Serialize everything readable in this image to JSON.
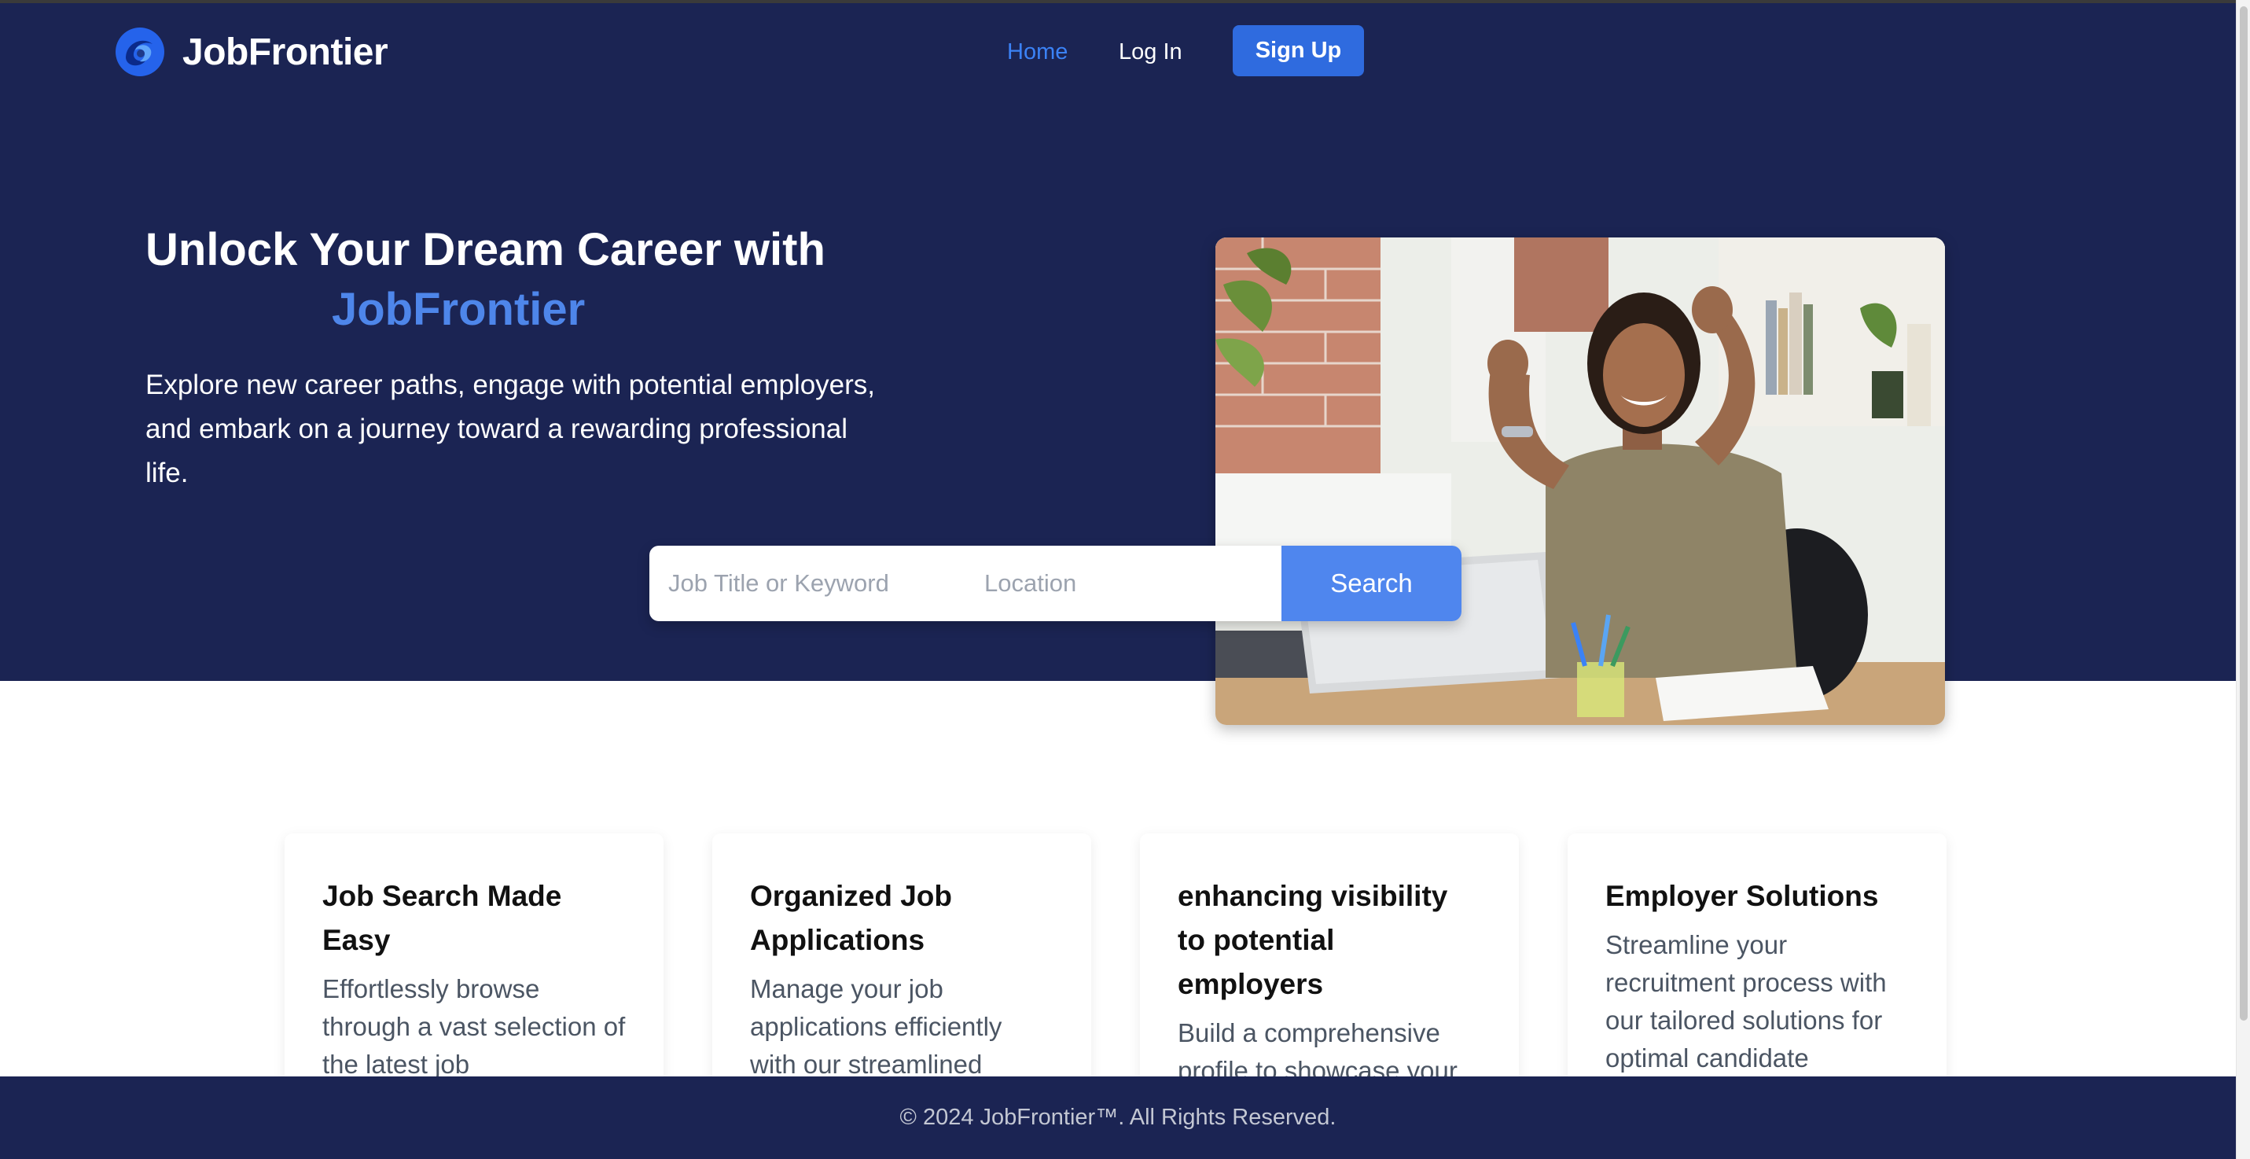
{
  "brand": {
    "name": "JobFrontier"
  },
  "nav": {
    "home": "Home",
    "login": "Log In",
    "signup": "Sign Up"
  },
  "hero": {
    "headline": "Unlock Your Dream Career with",
    "headline_brand": "JobFrontier",
    "subtext": "Explore new career paths, engage with potential employers, and embark on a journey toward a rewarding professional life."
  },
  "search": {
    "keyword_placeholder": "Job Title or Keyword",
    "location_placeholder": "Location",
    "button": "Search"
  },
  "features": [
    {
      "title": "Job Search Made Easy",
      "body": "Effortlessly browse through a vast selection of the latest job opportunities, tailored to"
    },
    {
      "title": "Organized Job Applications",
      "body": "Manage your job applications efficiently with our streamlined"
    },
    {
      "title": "enhancing visibility to potential employers",
      "body": "Build a comprehensive profile to showcase your full professional"
    },
    {
      "title": "Employer Solutions",
      "body": "Streamline your recruitment process with our tailored solutions for optimal candidate"
    }
  ],
  "footer": {
    "text": "© 2024 JobFrontier™. All Rights Reserved."
  },
  "colors": {
    "navy": "#1b2453",
    "accent": "#2f6bdf",
    "brand_text": "#4e86ea",
    "search_button": "#4f86ee"
  },
  "icons": {
    "logo": "jobfrontier-logo-icon"
  }
}
